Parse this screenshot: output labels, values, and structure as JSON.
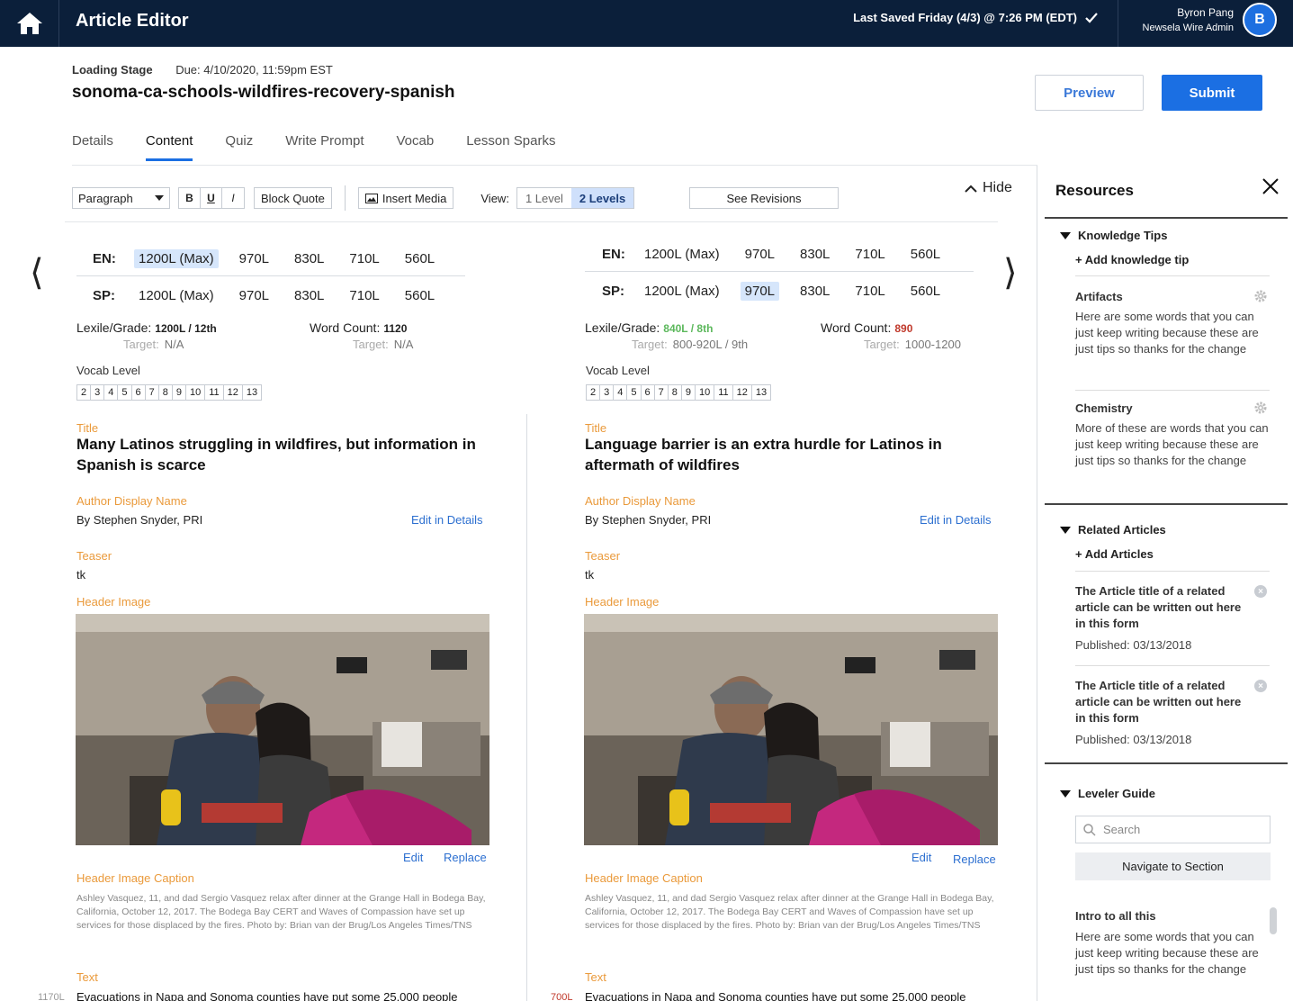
{
  "topbar": {
    "title": "Article Editor",
    "last_saved": "Last Saved Friday (4/3) @ 7:26 PM (EDT)",
    "user_name": "Byron Pang",
    "user_role": "Newsela Wire Admin",
    "avatar_initial": "B"
  },
  "header": {
    "stage": "Loading Stage",
    "due": "Due: 4/10/2020, 11:59pm EST",
    "slug": "sonoma-ca-schools-wildfires-recovery-spanish",
    "preview_label": "Preview",
    "submit_label": "Submit"
  },
  "tabs": [
    "Details",
    "Content",
    "Quiz",
    "Write Prompt",
    "Vocab",
    "Lesson Sparks"
  ],
  "active_tab": "Content",
  "toolbar": {
    "paragraph": "Paragraph",
    "bold": "B",
    "underline": "U",
    "italic": "I",
    "block_quote": "Block Quote",
    "insert_media": "Insert Media",
    "view_label": "View:",
    "view_one": "1 Level",
    "view_two": "2 Levels",
    "see_revisions": "See Revisions",
    "hide": "Hide"
  },
  "levels": [
    "1200L (Max)",
    "970L",
    "830L",
    "710L",
    "560L"
  ],
  "vocab_levels": [
    "2",
    "3",
    "4",
    "5",
    "6",
    "7",
    "8",
    "9",
    "10",
    "11",
    "12",
    "13"
  ],
  "columns": [
    {
      "en_label": "EN:",
      "sp_label": "SP:",
      "selected_en": "1200L (Max)",
      "selected_sp": "",
      "lexile_label": "Lexile/Grade:",
      "lexile_value": "1200L / 12th",
      "lexile_target_label": "Target:",
      "lexile_target": "N/A",
      "word_count_label": "Word Count:",
      "word_count": "1120",
      "word_target_label": "Target:",
      "word_target": "N/A",
      "vocab_label": "Vocab Level",
      "title_label": "Title",
      "title": "Many Latinos struggling in wildfires, but information in Spanish is scarce",
      "author_label": "Author Display Name",
      "author": "By Stephen Snyder, PRI",
      "edit_in_details": "Edit in Details",
      "teaser_label": "Teaser",
      "teaser": "tk",
      "header_image_label": "Header Image",
      "edit": "Edit",
      "replace": "Replace",
      "caption_label": "Header Image Caption",
      "caption": "Ashley Vasquez, 11, and dad Sergio Vasquez relax after dinner at the Grange Hall in Bodega Bay, California, October 12, 2017. The Bodega Bay CERT and Waves of Compassion have set up services for those displaced by the fires. Photo by: Brian van der Brug/Los Angeles Times/TNS",
      "text_label": "Text",
      "text": "Evacuations in Napa and Sonoma counties have put some 25,000 people",
      "margin_lexile": "1170L"
    },
    {
      "en_label": "EN:",
      "sp_label": "SP:",
      "selected_en": "",
      "selected_sp": "970L",
      "lexile_label": "Lexile/Grade:",
      "lexile_value": "840L / 8th",
      "lexile_target_label": "Target:",
      "lexile_target": "800-920L / 9th",
      "word_count_label": "Word Count:",
      "word_count": "890",
      "word_target_label": "Target:",
      "word_target": "1000-1200",
      "vocab_label": "Vocab Level",
      "title_label": "Title",
      "title": "Language barrier is an extra hurdle for Latinos in aftermath of wildfires",
      "author_label": "Author Display Name",
      "author": "By Stephen Snyder, PRI",
      "edit_in_details": "Edit in Details",
      "teaser_label": "Teaser",
      "teaser": "tk",
      "header_image_label": "Header Image",
      "edit": "Edit",
      "replace": "Replace",
      "caption_label": "Header Image Caption",
      "caption": "Ashley Vasquez, 11, and dad Sergio Vasquez relax after dinner at the Grange Hall in Bodega Bay, California, October 12, 2017. The Bodega Bay CERT and Waves of Compassion have set up services for those displaced by the fires. Photo by: Brian van der Brug/Los Angeles Times/TNS",
      "text_label": "Text",
      "text": "Evacuations in Napa and Sonoma counties have put some 25,000 people",
      "margin_lexile": "700L"
    }
  ],
  "resources": {
    "title": "Resources",
    "knowledge_tips": "Knowledge Tips",
    "add_tip": "+ Add knowledge tip",
    "tips": [
      {
        "title": "Artifacts",
        "body": "Here are some words that you can just keep writing because these are just tips so thanks for the change"
      },
      {
        "title": "Chemistry",
        "body": "More of these are words that you can just keep writing because these are just tips so thanks for the change"
      }
    ],
    "related_articles": "Related Articles",
    "add_articles": "+ Add Articles",
    "articles": [
      {
        "title": "The Article title of a related article can be written out here in this form",
        "published": "Published: 03/13/2018"
      },
      {
        "title": "The Article title of a related article can be written out here in this form",
        "published": "Published: 03/13/2018"
      }
    ],
    "leveler_guide": "Leveler Guide",
    "search_placeholder": "Search",
    "navigate": "Navigate to Section",
    "intro_title": "Intro to all this",
    "intro_body": "Here are some words that you can just keep writing because these are just tips so thanks for the change"
  },
  "colors": {
    "topbar": "#0b1f3a",
    "accent": "#1b6fe3",
    "field_label": "#ea9a3b",
    "green": "#5cb85c",
    "red": "#c0392b"
  }
}
